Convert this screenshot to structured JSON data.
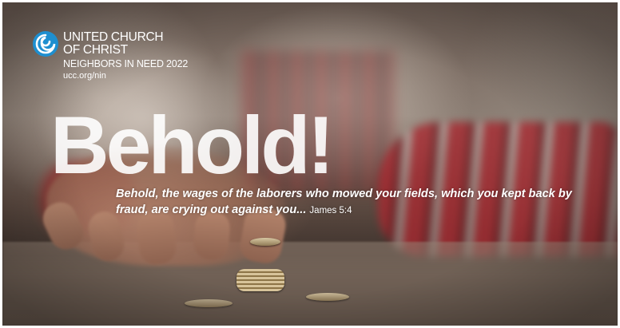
{
  "logo": {
    "icon": "ucc-swirl-icon",
    "org_line1": "UNITED CHURCH",
    "org_line2": "OF CHRIST",
    "campaign": "NEIGHBORS IN NEED 2022",
    "url": "ucc.org/nin"
  },
  "headline": "Behold!",
  "verse": {
    "text": "Behold, the wages of the laborers who mowed your fields, which you kept back by fraud, are crying out against you...",
    "citation": "James 5:4"
  },
  "colors": {
    "logo_blue": "#1e8fd0",
    "text": "#ffffff"
  }
}
